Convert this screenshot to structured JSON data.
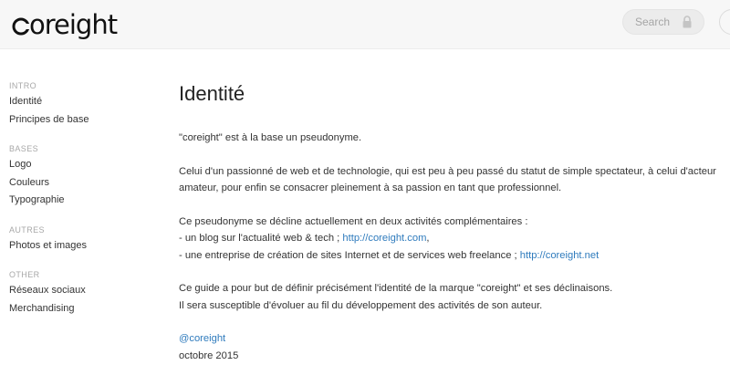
{
  "header": {
    "logo_text": "coreight",
    "search_placeholder": "Search"
  },
  "sidebar": {
    "sections": [
      {
        "title": "INTRO",
        "items": [
          "Identité",
          "Principes de base"
        ]
      },
      {
        "title": "BASES",
        "items": [
          "Logo",
          "Couleurs",
          "Typographie"
        ]
      },
      {
        "title": "AUTRES",
        "items": [
          "Photos et images"
        ]
      },
      {
        "title": "OTHER",
        "items": [
          "Réseaux sociaux",
          "Merchandising"
        ]
      }
    ]
  },
  "main": {
    "title": "Identité",
    "p1": "\"coreight\" est à la base un pseudonyme.",
    "p2_line1": "Celui d'un passionné de web et de technologie, qui est peu à peu passé du statut de simple spectateur, à celui d'acteur",
    "p2_line2": "amateur, pour enfin se consacrer pleinement à sa passion en tant que professionnel.",
    "p3_line1": "Ce pseudonyme se décline actuellement en deux activités complémentaires :",
    "p3_line2_prefix": "- un blog sur l'actualité web & tech ; ",
    "p3_link1": "http://coreight.com",
    "p3_line2_suffix": ",",
    "p3_line3_prefix": "- une entreprise de création de sites Internet et de services web freelance ; ",
    "p3_link2": "http://coreight.net",
    "p4_line1": "Ce guide a pour but de définir précisément l'identité de la marque \"coreight\" et ses déclinaisons.",
    "p4_line2": "Il sera susceptible d'évoluer au fil du développement des activités de son auteur.",
    "signature_link": "@coreight",
    "date": "octobre 2015"
  },
  "colors": {
    "link": "#2f7bbd",
    "topbar": "#f7f7f7"
  }
}
